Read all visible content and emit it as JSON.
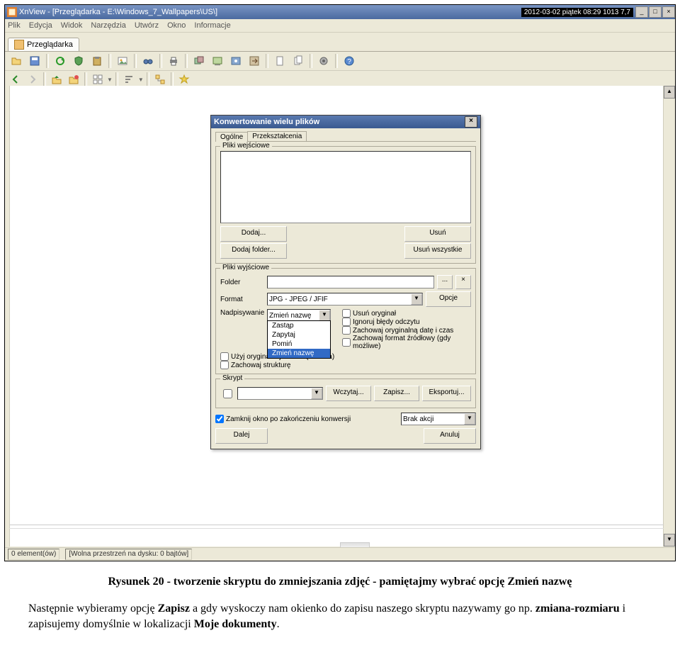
{
  "app": {
    "titlebar": "XnView - [Przeglądarka - E:\\Windows_7_Wallpapers\\US\\]",
    "clock": "2012-03-02 piątek 08:29  1013  7,7"
  },
  "menu": [
    "Plik",
    "Edycja",
    "Widok",
    "Narzędzia",
    "Utwórz",
    "Okno",
    "Informacje"
  ],
  "tab": {
    "label": "Przeglądarka"
  },
  "status": {
    "elements": "0 element(ów)",
    "disk": "[Wolna przestrzeń na dysku: 0 bajtów]"
  },
  "dialog": {
    "title": "Konwertowanie wielu plików",
    "tabs": [
      "Ogólne",
      "Przekształcenia"
    ],
    "fs_in": "Pliki wejściowe",
    "btn_add": "Dodaj...",
    "btn_add_folder": "Dodaj folder...",
    "btn_remove": "Usuń",
    "btn_remove_all": "Usuń wszystkie",
    "fs_out": "Pliki wyjściowe",
    "lbl_folder": "Folder",
    "lbl_format": "Format",
    "format_value": "JPG - JPEG / JFIF",
    "btn_browse": "...",
    "btn_options": "Opcje",
    "lbl_overwrite": "Nadpisywanie",
    "overwrite_value": "Zmień nazwę",
    "overwrite_options": [
      "Zastąp",
      "Zapytaj",
      "Pomiń",
      "Zmień nazwę"
    ],
    "chk_use_original": "Użyj oryginalnej ścieżki (ścieżka)",
    "chk_keep_str": "Zachowaj strukturę",
    "chk_del_orig": "Usuń oryginał",
    "chk_ignore_err": "Ignoruj błędy odczytu",
    "chk_keep_date": "Zachowaj oryginalną datę i czas",
    "chk_keep_src": "Zachowaj format źródłowy (gdy możliwe)",
    "fs_script": "Skrypt",
    "btn_load": "Wczytaj...",
    "btn_save": "Zapisz...",
    "btn_export": "Eksportuj...",
    "chk_close": "Zamknij okno po zakończeniu konwersji",
    "end_action": "Brak akcji",
    "btn_next": "Dalej",
    "btn_cancel": "Anuluj"
  },
  "doc": {
    "caption": "Rysunek 20 - tworzenie skryptu do zmniejszania zdjęć - pamiętajmy wybrać opcję Zmień nazwę",
    "p1a": "Następnie wybieramy opcję ",
    "p1b": "Zapisz",
    "p1c": " a gdy wyskoczy nam okienko do zapisu naszego skryptu nazywamy go np. ",
    "p1d": "zmiana-rozmiaru",
    "p1e": " i zapisujemy domyślnie w lokalizacji ",
    "p1f": "Moje dokumenty",
    "p1g": "."
  }
}
